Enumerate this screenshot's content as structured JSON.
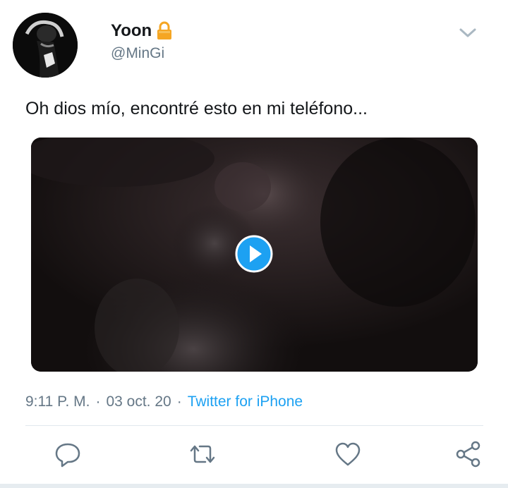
{
  "user": {
    "name": "Yoon",
    "handle": "@MinGi",
    "avatar_icon": "avatar-photo",
    "lock_icon": "lock-icon"
  },
  "tweet": {
    "text": "Oh dios mío, encontré esto en mi teléfono...",
    "media_type": "video",
    "time": "9:11 P. M.",
    "date": "03 oct. 20",
    "separator": "·",
    "source": "Twitter for iPhone"
  },
  "actions": [
    "reply-icon",
    "retweet-icon",
    "like-icon",
    "share-icon"
  ],
  "colors": {
    "accent": "#1da1f2",
    "text": "#14171a",
    "secondary": "#657786",
    "lock": "#f5a623"
  }
}
